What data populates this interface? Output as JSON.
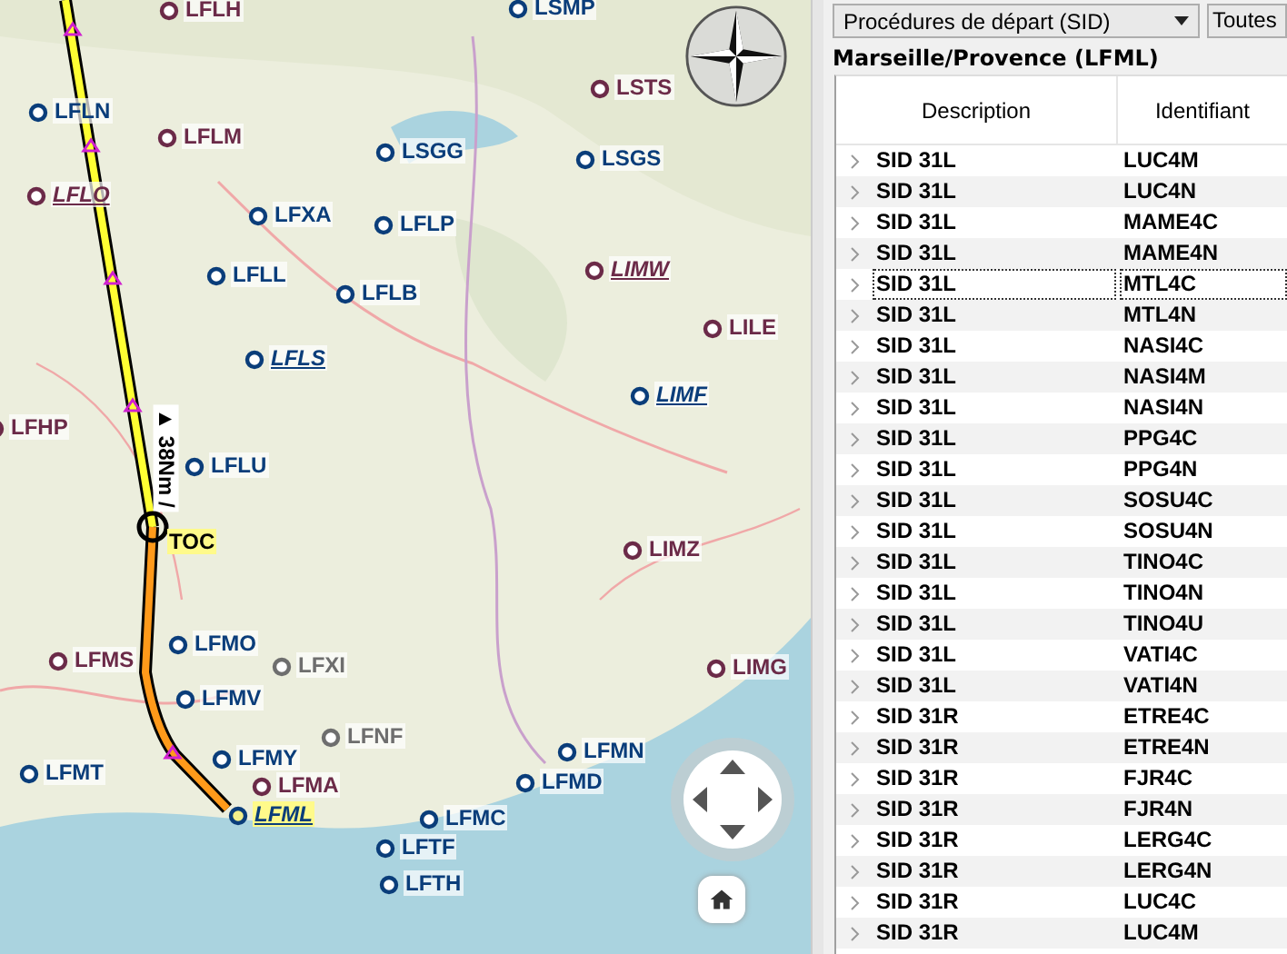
{
  "map": {
    "route_label": "▲ 38Nm /",
    "airports": [
      {
        "label": "LFLH",
        "color": "#6b2a48",
        "kind": "plain"
      },
      {
        "label": "LSMP",
        "color": "#0a3d7a",
        "kind": "plain"
      },
      {
        "label": "LSTS",
        "color": "#6b2a48",
        "kind": "plain"
      },
      {
        "label": "LFLN",
        "color": "#0a3d7a",
        "kind": "plain"
      },
      {
        "label": "LFLM",
        "color": "#6b2a48",
        "kind": "plain"
      },
      {
        "label": "LFLO",
        "color": "#6b2a48",
        "kind": "underlined"
      },
      {
        "label": "LSGG",
        "color": "#0a3d7a",
        "kind": "plain"
      },
      {
        "label": "LSGS",
        "color": "#0a3d7a",
        "kind": "plain"
      },
      {
        "label": "LFXA",
        "color": "#0a3d7a",
        "kind": "plain"
      },
      {
        "label": "LFLP",
        "color": "#0a3d7a",
        "kind": "plain"
      },
      {
        "label": "LFLL",
        "color": "#0a3d7a",
        "kind": "plain"
      },
      {
        "label": "LFLB",
        "color": "#0a3d7a",
        "kind": "plain"
      },
      {
        "label": "LIMW",
        "color": "#6b2a48",
        "kind": "underlined"
      },
      {
        "label": "LFLS",
        "color": "#0a3d7a",
        "kind": "underlined"
      },
      {
        "label": "LILE",
        "color": "#6b2a48",
        "kind": "plain"
      },
      {
        "label": "LIMF",
        "color": "#0a3d7a",
        "kind": "underlined"
      },
      {
        "label": "LFHP",
        "color": "#6b2a48",
        "kind": "plain"
      },
      {
        "label": "LFLU",
        "color": "#0a3d7a",
        "kind": "plain"
      },
      {
        "label": "TOC",
        "color": "#000000",
        "kind": "waypoint"
      },
      {
        "label": "LIMZ",
        "color": "#6b2a48",
        "kind": "plain"
      },
      {
        "label": "LFMO",
        "color": "#0a3d7a",
        "kind": "plain"
      },
      {
        "label": "LFMS",
        "color": "#6b2a48",
        "kind": "plain"
      },
      {
        "label": "LFXI",
        "color": "#6e6e6e",
        "kind": "plain"
      },
      {
        "label": "LIMG",
        "color": "#6b2a48",
        "kind": "plain"
      },
      {
        "label": "LFMV",
        "color": "#0a3d7a",
        "kind": "plain"
      },
      {
        "label": "LFNF",
        "color": "#6e6e6e",
        "kind": "plain"
      },
      {
        "label": "LFMT",
        "color": "#0a3d7a",
        "kind": "plain"
      },
      {
        "label": "LFMN",
        "color": "#0a3d7a",
        "kind": "plain"
      },
      {
        "label": "LFMD",
        "color": "#0a3d7a",
        "kind": "plain"
      },
      {
        "label": "LFMY",
        "color": "#0a3d7a",
        "kind": "plain"
      },
      {
        "label": "LFMA",
        "color": "#6b2a48",
        "kind": "plain"
      },
      {
        "label": "LFML",
        "color": "#0a3d7a",
        "kind": "destination"
      },
      {
        "label": "LFMC",
        "color": "#0a3d7a",
        "kind": "plain"
      },
      {
        "label": "LFTF",
        "color": "#0a3d7a",
        "kind": "plain"
      },
      {
        "label": "LFTH",
        "color": "#0a3d7a",
        "kind": "plain"
      }
    ]
  },
  "panel": {
    "procedure_select": "Procédures de départ (SID)",
    "filter_button": "Toutes",
    "airport_title": "Marseille/Provence (LFML)",
    "columns": [
      "Description",
      "Identifiant"
    ],
    "rows": [
      {
        "description": "SID 31L",
        "ident": "LUC4M",
        "focused": false
      },
      {
        "description": "SID 31L",
        "ident": "LUC4N",
        "focused": false
      },
      {
        "description": "SID 31L",
        "ident": "MAME4C",
        "focused": false
      },
      {
        "description": "SID 31L",
        "ident": "MAME4N",
        "focused": false
      },
      {
        "description": "SID 31L",
        "ident": "MTL4C",
        "focused": true
      },
      {
        "description": "SID 31L",
        "ident": "MTL4N",
        "focused": false
      },
      {
        "description": "SID 31L",
        "ident": "NASI4C",
        "focused": false
      },
      {
        "description": "SID 31L",
        "ident": "NASI4M",
        "focused": false
      },
      {
        "description": "SID 31L",
        "ident": "NASI4N",
        "focused": false
      },
      {
        "description": "SID 31L",
        "ident": "PPG4C",
        "focused": false
      },
      {
        "description": "SID 31L",
        "ident": "PPG4N",
        "focused": false
      },
      {
        "description": "SID 31L",
        "ident": "SOSU4C",
        "focused": false
      },
      {
        "description": "SID 31L",
        "ident": "SOSU4N",
        "focused": false
      },
      {
        "description": "SID 31L",
        "ident": "TINO4C",
        "focused": false
      },
      {
        "description": "SID 31L",
        "ident": "TINO4N",
        "focused": false
      },
      {
        "description": "SID 31L",
        "ident": "TINO4U",
        "focused": false
      },
      {
        "description": "SID 31L",
        "ident": "VATI4C",
        "focused": false
      },
      {
        "description": "SID 31L",
        "ident": "VATI4N",
        "focused": false
      },
      {
        "description": "SID 31R",
        "ident": "ETRE4C",
        "focused": false
      },
      {
        "description": "SID 31R",
        "ident": "ETRE4N",
        "focused": false
      },
      {
        "description": "SID 31R",
        "ident": "FJR4C",
        "focused": false
      },
      {
        "description": "SID 31R",
        "ident": "FJR4N",
        "focused": false
      },
      {
        "description": "SID 31R",
        "ident": "LERG4C",
        "focused": false
      },
      {
        "description": "SID 31R",
        "ident": "LERG4N",
        "focused": false
      },
      {
        "description": "SID 31R",
        "ident": "LUC4C",
        "focused": false
      },
      {
        "description": "SID 31R",
        "ident": "LUC4M",
        "focused": false
      }
    ]
  }
}
